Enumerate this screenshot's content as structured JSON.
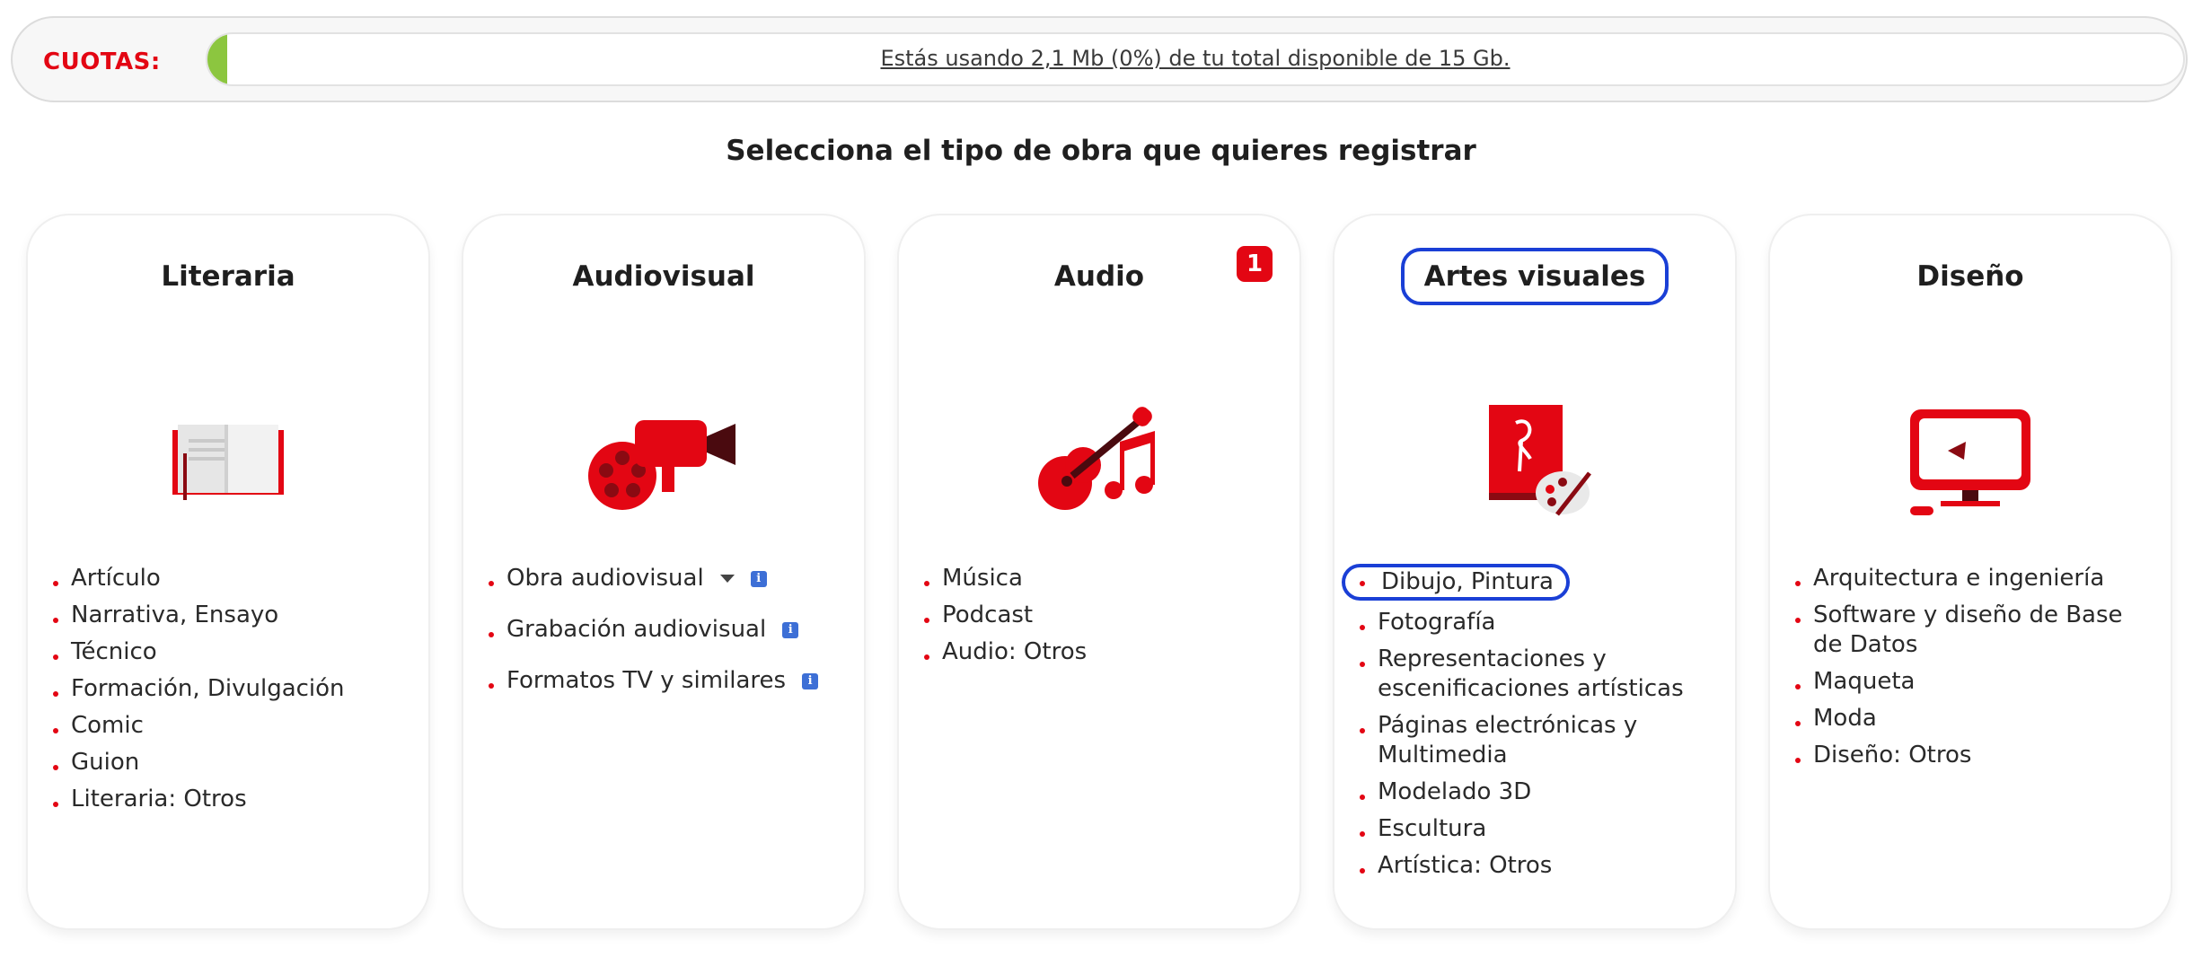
{
  "quota": {
    "label": "CUOTAS:",
    "text": "Estás usando 2,1 Mb (0%) de tu total disponible de 15 Gb.",
    "usage_percent": 0,
    "fill_color": "#8cc63f"
  },
  "heading": "Selecciona el tipo de obra que quieres registrar",
  "accent_color": "#e30613",
  "highlight_color": "#1a3fd6",
  "cards": [
    {
      "title": "Literaria",
      "icon": "book-icon",
      "items": [
        "Artículo",
        "Narrativa, Ensayo",
        "Técnico",
        "Formación, Divulgación",
        "Comic",
        "Guion",
        "Literaria: Otros"
      ]
    },
    {
      "title": "Audiovisual",
      "icon": "film-camera-icon",
      "items": [
        "Obra audiovisual",
        "Grabación audiovisual",
        "Formatos TV y similares"
      ]
    },
    {
      "title": "Audio",
      "icon": "guitar-music-icon",
      "badge": "1",
      "items": [
        "Música",
        "Podcast",
        "Audio: Otros"
      ]
    },
    {
      "title": "Artes visuales",
      "icon": "art-palette-icon",
      "items": [
        "Dibujo, Pintura",
        "Fotografía",
        "Representaciones y escenificaciones artísticas",
        "Páginas electrónicas y Multimedia",
        "Modelado 3D",
        "Escultura",
        "Artística: Otros"
      ]
    },
    {
      "title": "Diseño",
      "icon": "monitor-icon",
      "items": [
        "Arquitectura e ingeniería",
        "Software y diseño de Base de Datos",
        "Maqueta",
        "Moda",
        "Diseño: Otros"
      ]
    }
  ]
}
